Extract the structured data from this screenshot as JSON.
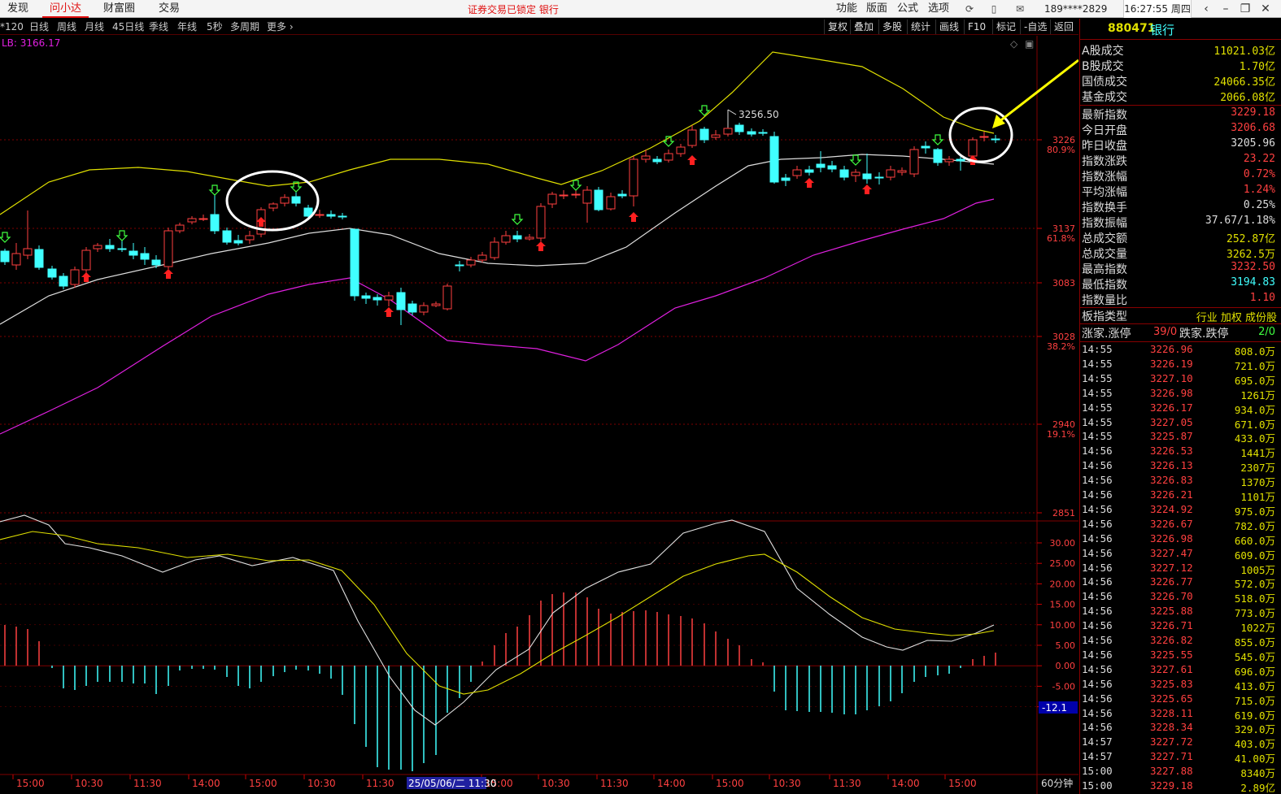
{
  "topbar": {
    "tabs": [
      "发现",
      "问小达",
      "财富圈",
      "交易"
    ],
    "active_tab": "问小达",
    "lock_message": "证券交易已锁定  银行",
    "menu": [
      "功能",
      "版面",
      "公式",
      "选项"
    ],
    "account": "189****2829",
    "clock": "16:27:55 周四"
  },
  "chart_toolbar": {
    "periods": [
      "*120",
      "日线",
      "周线",
      "月线",
      "45日线",
      "季线",
      "年线",
      "5秒",
      "多周期",
      "更多 ›"
    ],
    "right_buttons": [
      "复权",
      "叠加",
      "多股",
      "统计",
      "画线",
      "F10",
      "标记",
      "-自选",
      "返回"
    ],
    "period_label": "60分钟"
  },
  "price_chart": {
    "indicator_label": "LB: 3166.17",
    "axis_labels": [
      {
        "value": "3226",
        "pct": "80.9%"
      },
      {
        "value": "3137",
        "pct": "61.8%"
      },
      {
        "value": "3083",
        "pct": ""
      },
      {
        "value": "3028",
        "pct": "38.2%"
      },
      {
        "value": "2940",
        "pct": "19.1%"
      },
      {
        "value": "2851",
        "pct": ""
      }
    ],
    "high_marker": "3256.50"
  },
  "macd": {
    "axis_labels": [
      "30.00",
      "25.00",
      "20.00",
      "15.00",
      "10.00",
      "5.00",
      "0.00",
      "-5.00",
      "-10.00"
    ],
    "current_value": "-12.1"
  },
  "time_axis": {
    "labels": [
      "15:00",
      "10:30",
      "11:30",
      "14:00",
      "15:00",
      "10:30",
      "11:30",
      "15:00",
      "10:30",
      "11:30",
      "14:00",
      "15:00",
      "10:30",
      "11:30",
      "14:00",
      "15:00"
    ],
    "cursor_label": "25/05/06/二 11:30"
  },
  "right_panel": {
    "code": "880471",
    "name": "银行",
    "summary": [
      {
        "k": "A股成交",
        "v": "11021.03亿",
        "color": "yellow"
      },
      {
        "k": "B股成交",
        "v": "1.70亿",
        "color": "yellow"
      },
      {
        "k": "国债成交",
        "v": "24066.35亿",
        "color": "yellow"
      },
      {
        "k": "基金成交",
        "v": "2066.08亿",
        "color": "yellow"
      }
    ],
    "quote": [
      {
        "k": "最新指数",
        "v": "3229.18",
        "color": "red"
      },
      {
        "k": "今日开盘",
        "v": "3206.68",
        "color": "red"
      },
      {
        "k": "昨日收盘",
        "v": "3205.96",
        "color": "white"
      },
      {
        "k": "指数涨跌",
        "v": "23.22",
        "color": "red"
      },
      {
        "k": "指数涨幅",
        "v": "0.72%",
        "color": "red"
      },
      {
        "k": "平均涨幅",
        "v": "1.24%",
        "color": "red"
      },
      {
        "k": "指数换手",
        "v": "0.25%",
        "color": "white"
      },
      {
        "k": "指数振幅",
        "v": "37.67/1.18%",
        "color": "white"
      },
      {
        "k": "总成交额",
        "v": "252.87亿",
        "color": "yellow"
      },
      {
        "k": "总成交量",
        "v": "3262.5万",
        "color": "yellow"
      },
      {
        "k": "最高指数",
        "v": "3232.50",
        "color": "red"
      },
      {
        "k": "最低指数",
        "v": "3194.83",
        "color": "cyan"
      },
      {
        "k": "指数量比",
        "v": "1.10",
        "color": "red"
      }
    ],
    "board_type_label": "板指类型",
    "board_type_value": "行业 加权 成份股",
    "up_label": "涨家.涨停",
    "up_value": "39/0",
    "down_label": "跌家.跌停",
    "down_value": "2/0",
    "ticks": [
      [
        "14:55",
        "3226.96",
        "808.0万"
      ],
      [
        "14:55",
        "3226.19",
        "721.0万"
      ],
      [
        "14:55",
        "3227.10",
        "695.0万"
      ],
      [
        "14:55",
        "3226.98",
        "1261万"
      ],
      [
        "14:55",
        "3226.17",
        "934.0万"
      ],
      [
        "14:55",
        "3227.05",
        "671.0万"
      ],
      [
        "14:55",
        "3225.87",
        "433.0万"
      ],
      [
        "14:56",
        "3226.53",
        "1441万"
      ],
      [
        "14:56",
        "3226.13",
        "2307万"
      ],
      [
        "14:56",
        "3226.83",
        "1370万"
      ],
      [
        "14:56",
        "3226.21",
        "1101万"
      ],
      [
        "14:56",
        "3224.92",
        "975.0万"
      ],
      [
        "14:56",
        "3226.67",
        "782.0万"
      ],
      [
        "14:56",
        "3226.98",
        "660.0万"
      ],
      [
        "14:56",
        "3227.47",
        "609.0万"
      ],
      [
        "14:56",
        "3227.12",
        "1005万"
      ],
      [
        "14:56",
        "3226.77",
        "572.0万"
      ],
      [
        "14:56",
        "3226.70",
        "518.0万"
      ],
      [
        "14:56",
        "3225.88",
        "773.0万"
      ],
      [
        "14:56",
        "3226.71",
        "1022万"
      ],
      [
        "14:56",
        "3226.82",
        "855.0万"
      ],
      [
        "14:56",
        "3225.55",
        "545.0万"
      ],
      [
        "14:56",
        "3227.61",
        "696.0万"
      ],
      [
        "14:56",
        "3225.83",
        "413.0万"
      ],
      [
        "14:56",
        "3225.65",
        "715.0万"
      ],
      [
        "14:56",
        "3228.11",
        "619.0万"
      ],
      [
        "14:56",
        "3228.34",
        "329.0万"
      ],
      [
        "14:57",
        "3227.72",
        "403.0万"
      ],
      [
        "14:57",
        "3227.71",
        "41.00万"
      ],
      [
        "15:00",
        "3227.88",
        "8340万"
      ],
      [
        "15:00",
        "3229.18",
        "2.89亿"
      ]
    ]
  },
  "colors": {
    "up": "#ff4040",
    "down": "#40ffff",
    "upper_band": "#e0e000",
    "mid_band": "#dddddd",
    "lower_band": "#e020e0",
    "grid": "#800000",
    "annotation": "#ffff00"
  }
}
